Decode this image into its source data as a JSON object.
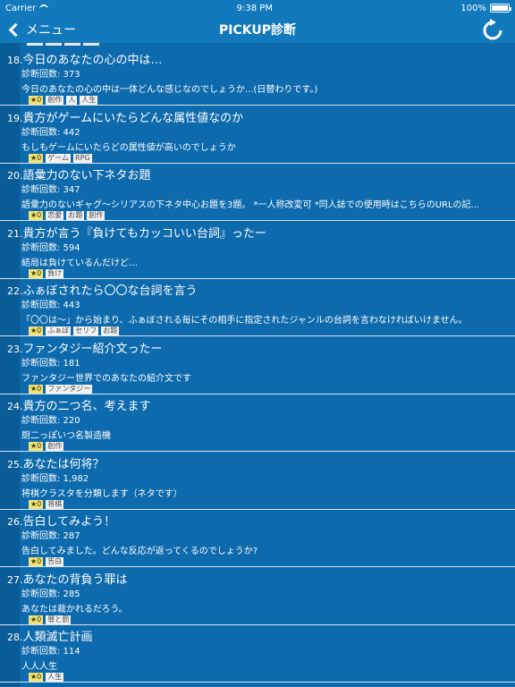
{
  "status": {
    "carrier": "Carrier",
    "time": "9:38 PM",
    "battery": "100%"
  },
  "nav": {
    "back_label": "メニュー",
    "title": "PICKUP診断"
  },
  "items": [
    {
      "num": "18.",
      "title": "今日のあなたの心の中は…",
      "count": "診断回数: 373",
      "desc": "今日のあなたの心の中は一体どんな感じなのでしょうか...(日替わりです。)",
      "star": "★0",
      "tags": [
        "創作",
        "人",
        "人生"
      ]
    },
    {
      "num": "19.",
      "title": "貴方がゲームにいたらどんな属性値なのか",
      "count": "診断回数: 442",
      "desc": "もしもゲームにいたらどの属性値が高いのでしょうか",
      "star": "★0",
      "tags": [
        "ゲーム",
        "RPG"
      ]
    },
    {
      "num": "20.",
      "title": "語彙力のない下ネタお題",
      "count": "診断回数: 347",
      "desc": "語彙力のないギャグ～シリアスの下ネタ中心お題を3題。 *一人称改変可 *同人誌での使用時はこちらのURLの記...",
      "star": "★0",
      "tags": [
        "恋愛",
        "お題",
        "創作"
      ]
    },
    {
      "num": "21.",
      "title": "貴方が言う『負けてもカッコいい台詞』ったー",
      "count": "診断回数: 594",
      "desc": "結局は負けているんだけど…",
      "star": "★0",
      "tags": [
        "負け"
      ]
    },
    {
      "num": "22.",
      "title": "ふぁぼされたら〇〇な台詞を言う",
      "count": "診断回数: 443",
      "desc": "「〇〇は〜」から始まり、ふぁぼされる毎にその相手に指定されたジャンルの台詞を言わなければいけません。",
      "star": "★0",
      "tags": [
        "ふぁぼ",
        "セリフ",
        "お題"
      ]
    },
    {
      "num": "23.",
      "title": "ファンタジー紹介文ったー",
      "count": "診断回数: 181",
      "desc": "ファンタジー世界でのあなたの紹介文です",
      "star": "★0",
      "tags": [
        "ファンタジー"
      ]
    },
    {
      "num": "24.",
      "title": "貴方の二つ名、考えます",
      "count": "診断回数: 220",
      "desc": "厨二っぽいつ名製造機",
      "star": "★0",
      "tags": [
        "創作"
      ]
    },
    {
      "num": "25.",
      "title": "あなたは何将？",
      "count": "診断回数: 1,982",
      "desc": "将棋クラスタを分類します（ネタです）",
      "star": "★0",
      "tags": [
        "将棋"
      ]
    },
    {
      "num": "26.",
      "title": "告白してみよう！",
      "count": "診断回数: 287",
      "desc": "告白してみました。どんな反応が返ってくるのでしょうか?",
      "star": "★0",
      "tags": [
        "告白"
      ]
    },
    {
      "num": "27.",
      "title": "あなたの背負う罪は",
      "count": "診断回数: 285",
      "desc": "あなたは裁かれるだろう。",
      "star": "★0",
      "tags": [
        "罪と罰"
      ]
    },
    {
      "num": "28.",
      "title": "人類滅亡計画",
      "count": "診断回数: 114",
      "desc": "人人人生",
      "star": "★0",
      "tags": [
        "人生"
      ]
    }
  ]
}
